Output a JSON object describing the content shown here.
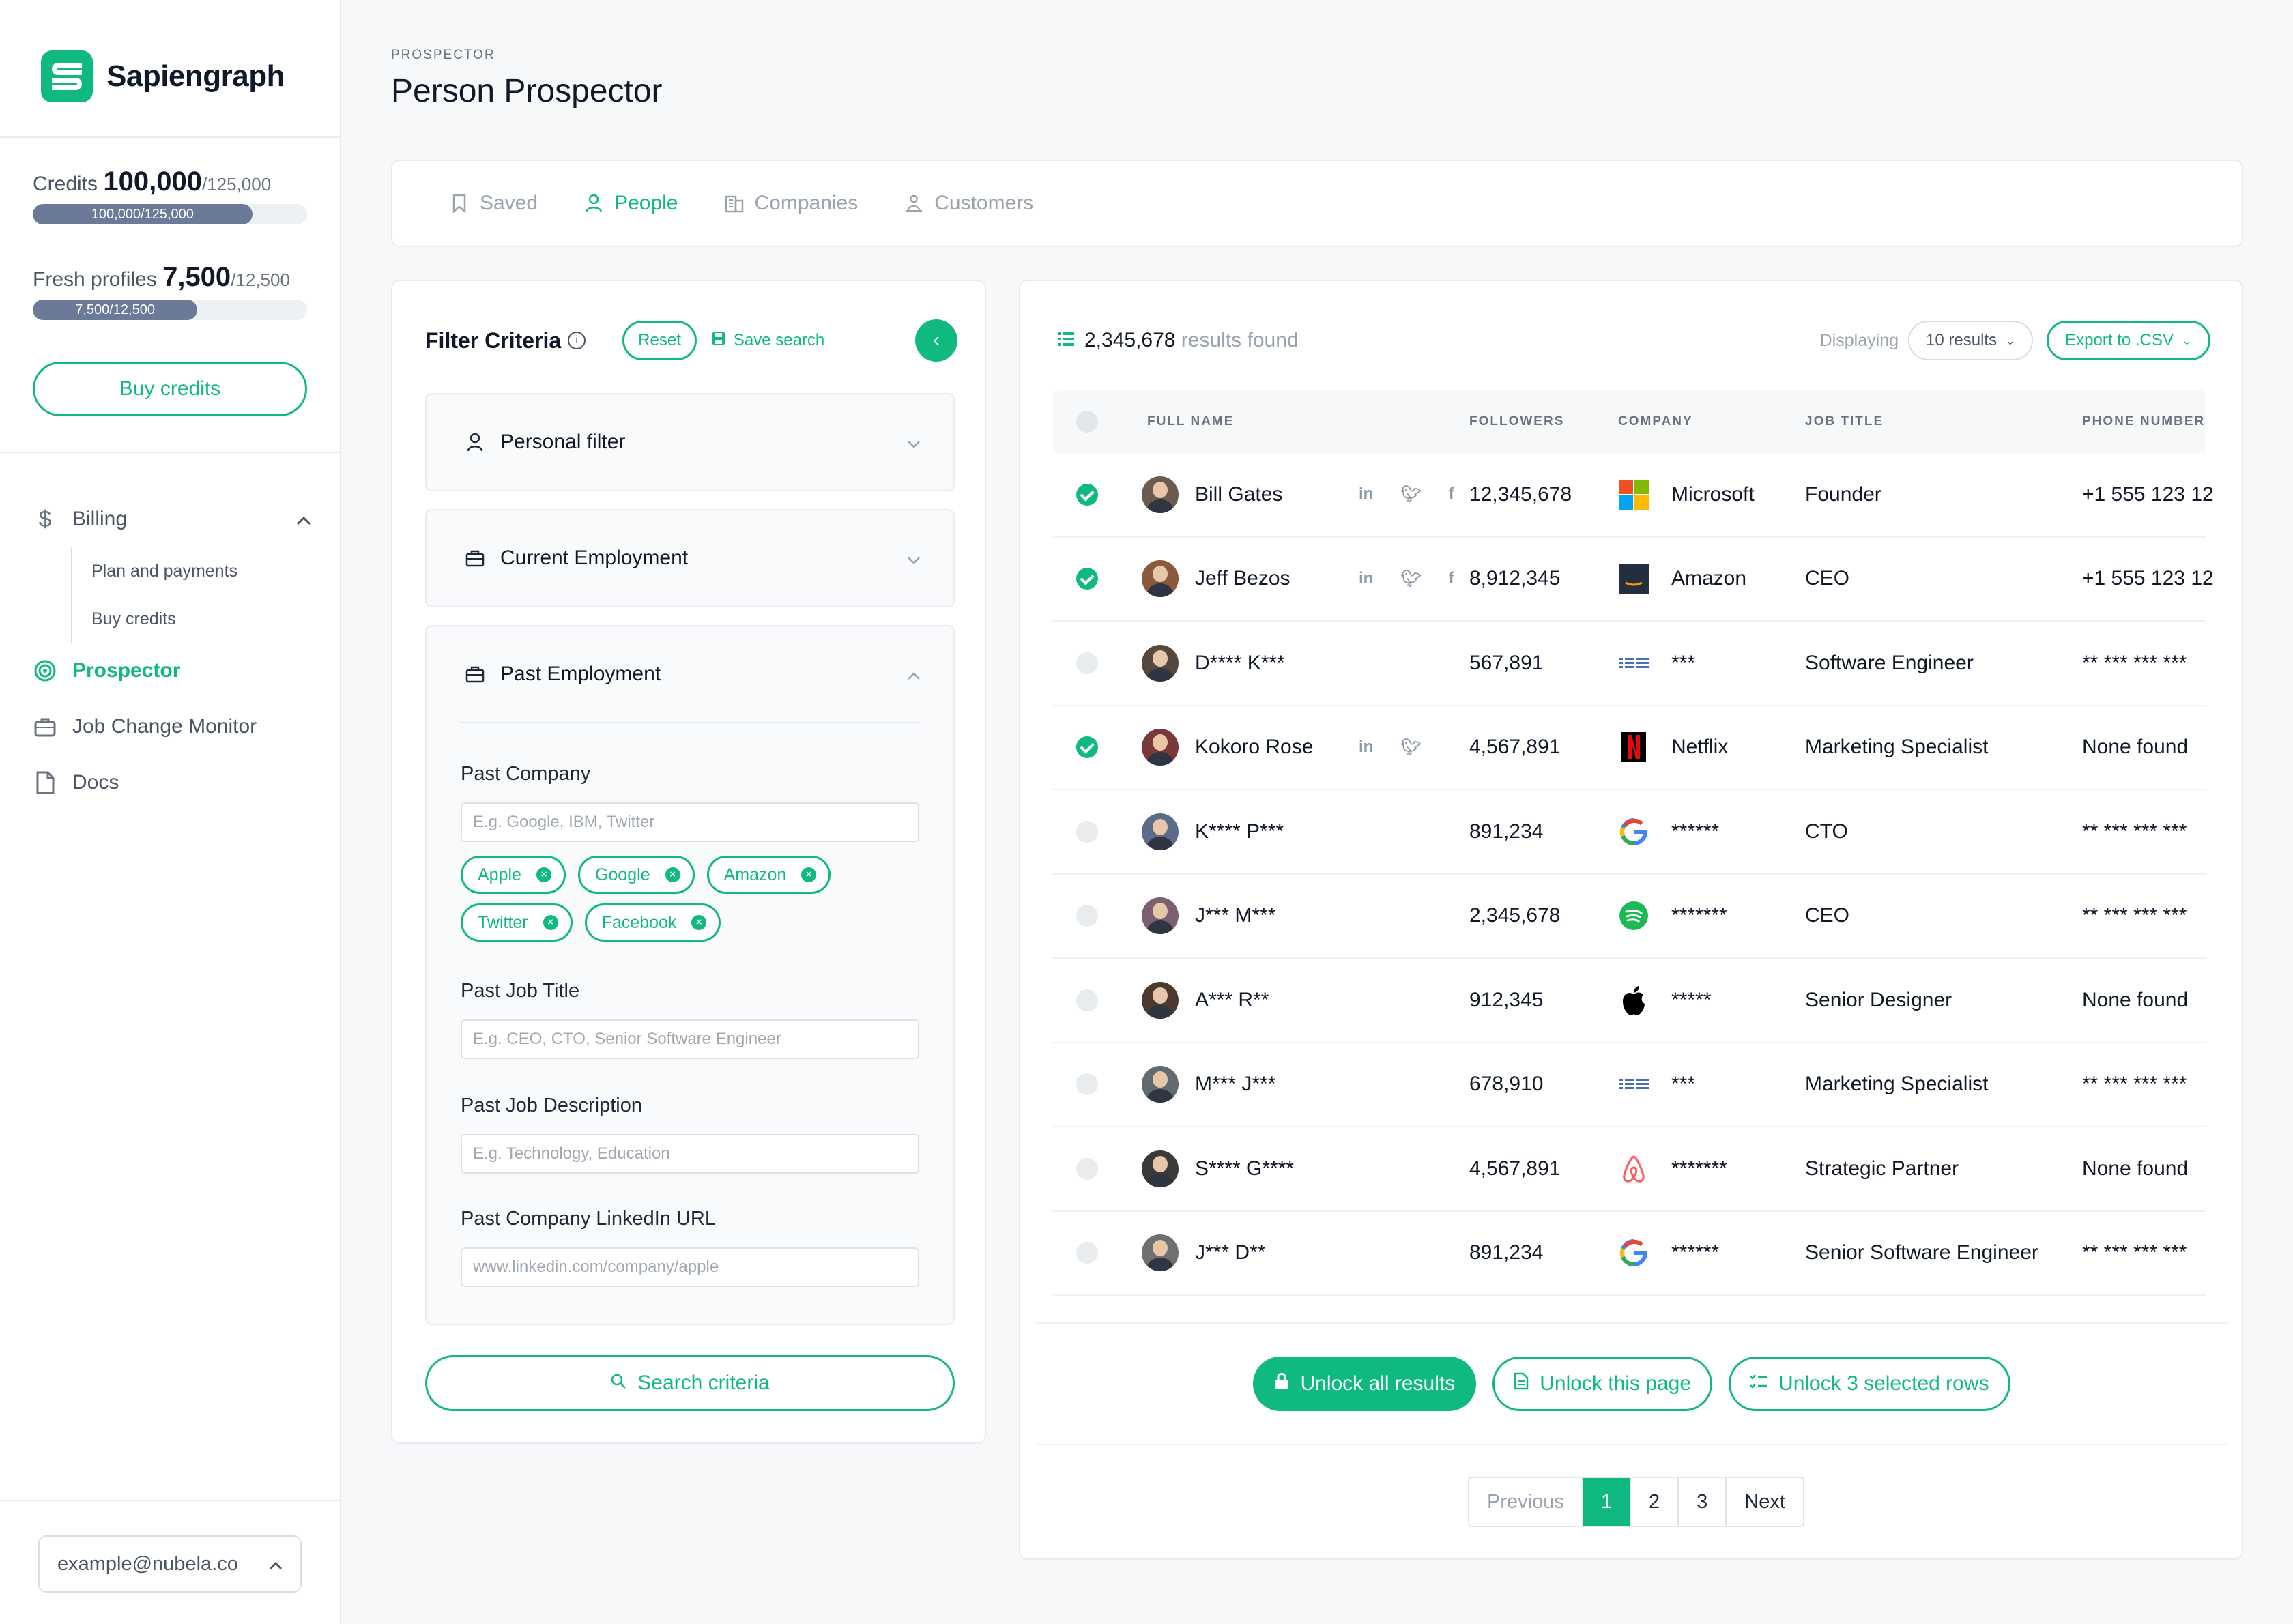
{
  "app": {
    "name": "Sapiengraph"
  },
  "credits": {
    "label": "Credits",
    "value": "100,000",
    "total": "/125,000",
    "bar_text": "100,000/125,000",
    "fraction": 0.8
  },
  "fresh": {
    "label": "Fresh profiles",
    "value": "7,500",
    "total": "/12,500",
    "bar_text": "7,500/12,500",
    "fraction": 0.6
  },
  "buy_credits_label": "Buy credits",
  "nav": {
    "billing": "Billing",
    "plan_payments": "Plan and payments",
    "buy_credits": "Buy credits",
    "prospector": "Prospector",
    "job_change": "Job Change Monitor",
    "docs": "Docs"
  },
  "user": {
    "email": "example@nubela.co"
  },
  "header": {
    "crumb": "PROSPECTOR",
    "title": "Person Prospector"
  },
  "tabs": {
    "saved": "Saved",
    "people": "People",
    "companies": "Companies",
    "customers": "Customers"
  },
  "filter": {
    "title": "Filter Criteria",
    "reset": "Reset",
    "save_search": "Save search",
    "personal": "Personal filter",
    "current": "Current Employment",
    "past": "Past Employment",
    "past_company_label": "Past Company",
    "past_company_placeholder": "E.g. Google, IBM, Twitter",
    "chips": [
      "Apple",
      "Google",
      "Amazon",
      "Twitter",
      "Facebook"
    ],
    "past_job_title_label": "Past Job Title",
    "past_job_title_placeholder": "E.g. CEO, CTO, Senior Software Engineer",
    "past_job_desc_label": "Past Job Description",
    "past_job_desc_placeholder": "E.g. Technology, Education",
    "past_linkedin_label": "Past Company LinkedIn URL",
    "past_linkedin_placeholder": "www.linkedin.com/company/apple",
    "search_btn": "Search criteria"
  },
  "results": {
    "count": "2,345,678",
    "count_suffix": " results found",
    "displaying": "Displaying",
    "display_select": "10 results",
    "export": "Export to .CSV",
    "columns": {
      "name": "FULL NAME",
      "followers": "FOLLOWERS",
      "company": "COMPANY",
      "job": "JOB TITLE",
      "phone": "PHONE NUMBER"
    },
    "rows": [
      {
        "checked": true,
        "name": "Bill Gates",
        "socials": [
          "in",
          "tw",
          "fb"
        ],
        "followers": "12,345,678",
        "logo": "microsoft",
        "company": "Microsoft",
        "job": "Founder",
        "phone": "+1 555 123 12"
      },
      {
        "checked": true,
        "name": "Jeff Bezos",
        "socials": [
          "in",
          "tw",
          "fb"
        ],
        "followers": "8,912,345",
        "logo": "amazon",
        "company": "Amazon",
        "job": "CEO",
        "phone": "+1 555 123 12"
      },
      {
        "checked": false,
        "name": "D**** K***",
        "socials": [],
        "followers": "567,891",
        "logo": "ibm",
        "company": "***",
        "job": "Software Engineer",
        "phone": "** *** *** ***"
      },
      {
        "checked": true,
        "name": "Kokoro Rose",
        "socials": [
          "in",
          "tw"
        ],
        "followers": "4,567,891",
        "logo": "netflix",
        "company": "Netflix",
        "job": "Marketing Specialist",
        "phone": "None found"
      },
      {
        "checked": false,
        "name": "K**** P***",
        "socials": [],
        "followers": "891,234",
        "logo": "google",
        "company": "******",
        "job": "CTO",
        "phone": "** *** *** ***"
      },
      {
        "checked": false,
        "name": "J*** M***",
        "socials": [],
        "followers": "2,345,678",
        "logo": "spotify",
        "company": "*******",
        "job": "CEO",
        "phone": "** *** *** ***"
      },
      {
        "checked": false,
        "name": "A*** R**",
        "socials": [],
        "followers": "912,345",
        "logo": "apple",
        "company": "*****",
        "job": "Senior Designer",
        "phone": "None found"
      },
      {
        "checked": false,
        "name": "M*** J***",
        "socials": [],
        "followers": "678,910",
        "logo": "ibm",
        "company": "***",
        "job": "Marketing Specialist",
        "phone": "** *** *** ***"
      },
      {
        "checked": false,
        "name": "S**** G****",
        "socials": [],
        "followers": "4,567,891",
        "logo": "airbnb",
        "company": "*******",
        "job": "Strategic Partner",
        "phone": "None found"
      },
      {
        "checked": false,
        "name": "J*** D**",
        "socials": [],
        "followers": "891,234",
        "logo": "google",
        "company": "******",
        "job": "Senior Software Engineer",
        "phone": "** *** *** ***"
      }
    ],
    "unlock_all": "Unlock all results",
    "unlock_page": "Unlock this page",
    "unlock_selected": "Unlock 3 selected rows",
    "pager": {
      "prev": "Previous",
      "pages": [
        "1",
        "2",
        "3"
      ],
      "next": "Next",
      "current": "1"
    }
  }
}
